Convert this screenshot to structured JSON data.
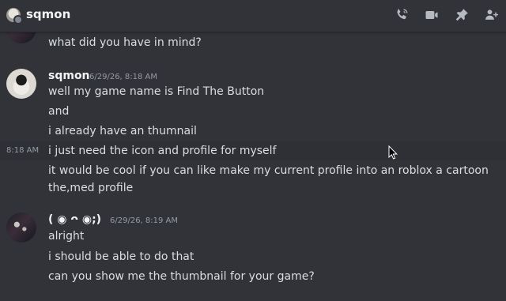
{
  "header": {
    "title": "sqmon",
    "icons": [
      "phone-call-icon",
      "video-camera-icon",
      "pin-icon",
      "add-member-icon"
    ]
  },
  "messages": {
    "partial": {
      "text": "what did you have in mind?"
    },
    "group1": {
      "author": "sqmon",
      "timestamp": "6/29/26, 8:18 AM",
      "lines": [
        "well my game name is Find The Button",
        "and",
        "i already have an thumnail",
        "i just need the icon and profile for myself",
        "it would be cool if you can like make my current profile into an roblox a cartoon",
        "the,med profile"
      ],
      "hover_time": "8:18 AM"
    },
    "group2": {
      "author": "( ◉ ᴖ ◉;)",
      "timestamp": "6/29/26, 8:19 AM",
      "lines": [
        "alright",
        "i should be able to do that",
        "can you show me the thumbnail for your game?"
      ]
    }
  },
  "colors": {
    "background": "#313338",
    "text": "#dbdee1",
    "muted": "#949ba4",
    "header_icon": "#b5bac1"
  }
}
